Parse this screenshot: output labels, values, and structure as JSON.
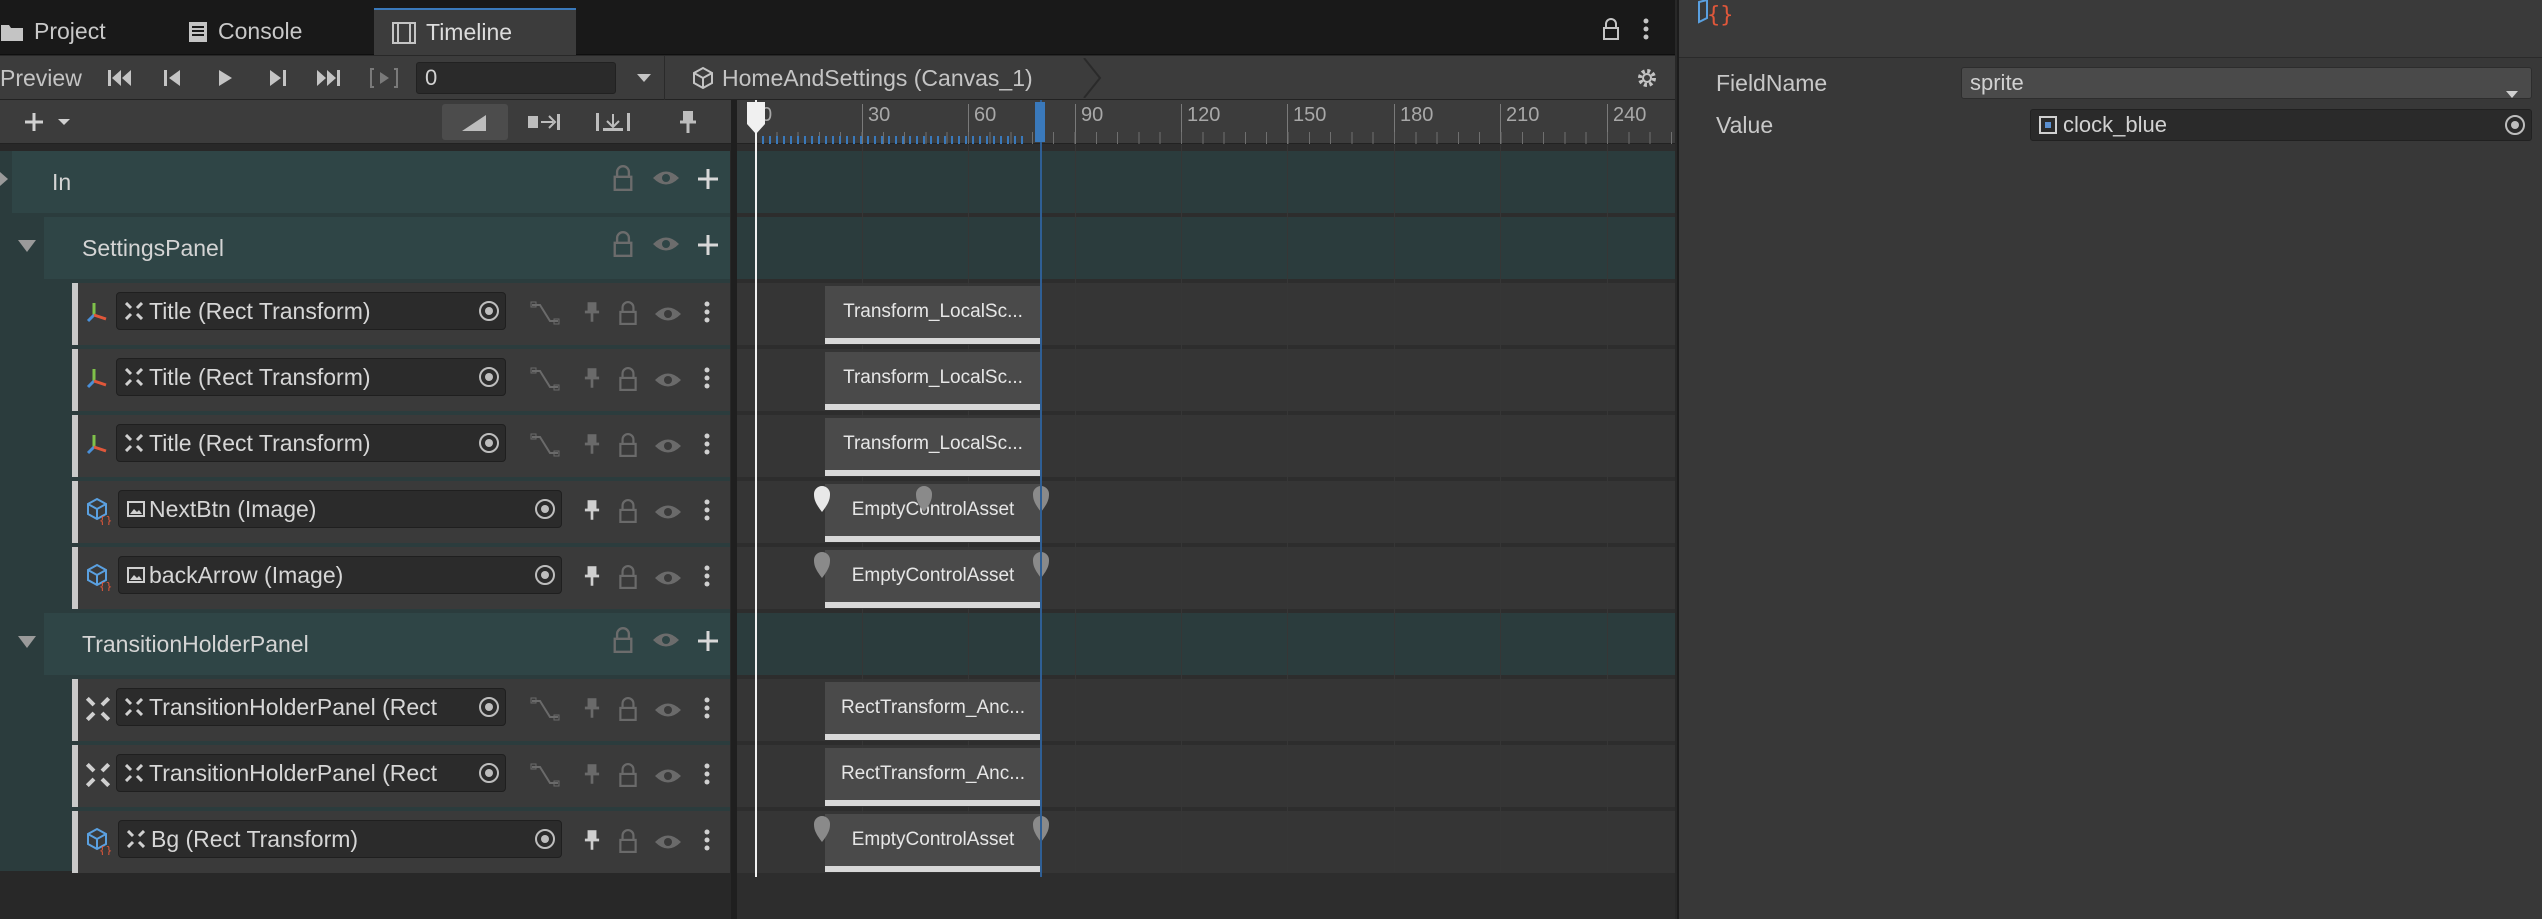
{
  "tabs": [
    {
      "label": "Project",
      "icon": "folder-icon"
    },
    {
      "label": "Console",
      "icon": "console-icon"
    },
    {
      "label": "Timeline",
      "icon": "timeline-icon",
      "active": true
    }
  ],
  "toolbar": {
    "preview_label": "Preview",
    "frame_value": "0",
    "breadcrumb": "HomeAndSettings (Canvas_1)"
  },
  "ruler": {
    "labels": [
      "0",
      "30",
      "60",
      "90",
      "120",
      "150",
      "180",
      "210",
      "240"
    ],
    "playhead_frame": 0
  },
  "groups": [
    {
      "name": "In"
    },
    {
      "name": "SettingsPanel"
    },
    {
      "name": "TransitionHolderPanel"
    }
  ],
  "tracks": [
    {
      "label": "Title (Rect Transform)",
      "clip": "Transform_LocalSc..."
    },
    {
      "label": "Title (Rect Transform)",
      "clip": "Transform_LocalSc..."
    },
    {
      "label": "Title (Rect Transform)",
      "clip": "Transform_LocalSc..."
    },
    {
      "label": "NextBtn (Image)",
      "clip": "EmptyControlAsset"
    },
    {
      "label": "backArrow (Image)",
      "clip": "EmptyControlAsset"
    },
    {
      "label": "TransitionHolderPanel (Rect",
      "clip": "RectTransform_Anc..."
    },
    {
      "label": "TransitionHolderPanel (Rect",
      "clip": "RectTransform_Anc..."
    },
    {
      "label": "Bg (Rect Transform)",
      "clip": "EmptyControlAsset"
    }
  ],
  "inspector": {
    "field_name_label": "FieldName",
    "field_name_value": "sprite",
    "value_label": "Value",
    "value_value": "clock_blue"
  },
  "colors": {
    "accent": "#3a79bb",
    "group_bg": "#2f4546",
    "track_bg": "#3a3a3a",
    "clip_bg": "#4a4a4a"
  }
}
